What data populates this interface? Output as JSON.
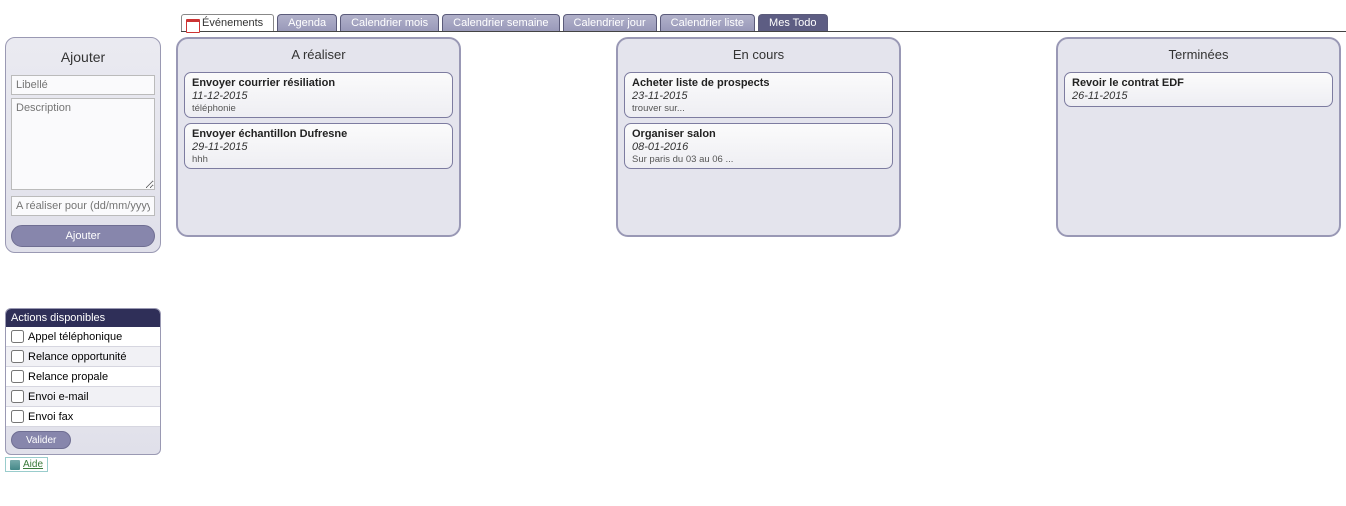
{
  "tabs": {
    "page_label": "Événements",
    "items": [
      "Agenda",
      "Calendrier mois",
      "Calendrier semaine",
      "Calendrier jour",
      "Calendrier liste",
      "Mes Todo"
    ],
    "active_index": 5
  },
  "add_form": {
    "title": "Ajouter",
    "libelle_placeholder": "Libellé",
    "desc_placeholder": "Description",
    "date_placeholder": "A réaliser pour (dd/mm/yyyy)",
    "submit_label": "Ajouter"
  },
  "actions": {
    "title": "Actions disponibles",
    "items": [
      "Appel téléphonique",
      "Relance opportunité",
      "Relance propale",
      "Envoi e-mail",
      "Envoi fax"
    ],
    "validate_label": "Valider"
  },
  "help_label": "Aide",
  "columns": [
    {
      "title": "A réaliser",
      "cards": [
        {
          "title": "Envoyer courrier résiliation",
          "date": "11-12-2015",
          "note": "téléphonie"
        },
        {
          "title": "Envoyer échantillon Dufresne",
          "date": "29-11-2015",
          "note": "hhh"
        }
      ]
    },
    {
      "title": "En cours",
      "cards": [
        {
          "title": "Acheter liste de prospects",
          "date": "23-11-2015",
          "note": "trouver sur..."
        },
        {
          "title": "Organiser salon",
          "date": "08-01-2016",
          "note": "Sur paris du 03 au 06 ..."
        }
      ]
    },
    {
      "title": "Terminées",
      "cards": [
        {
          "title": "Revoir le contrat EDF",
          "date": "26-11-2015",
          "note": ""
        }
      ]
    }
  ]
}
